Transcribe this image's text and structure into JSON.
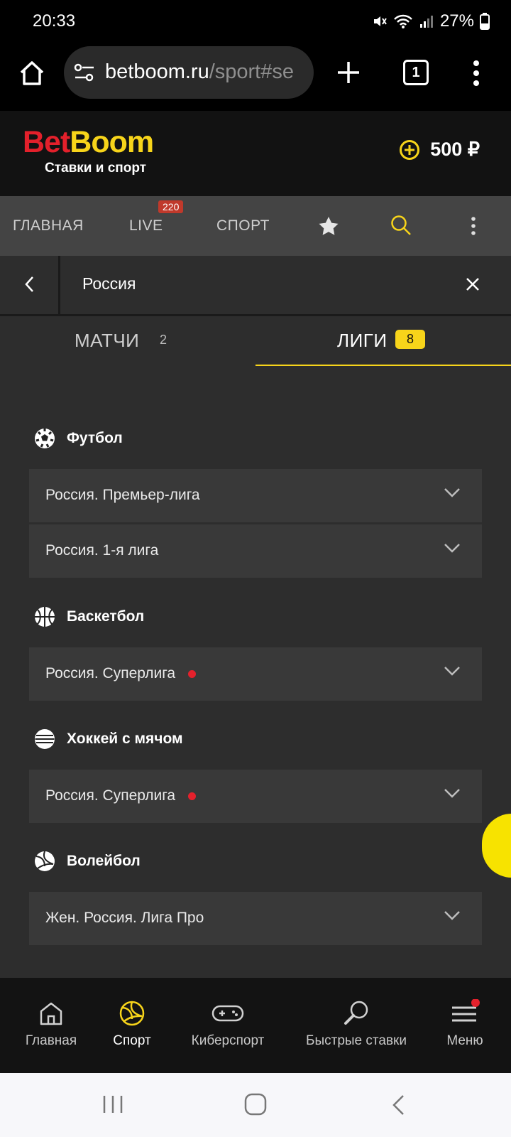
{
  "status_bar": {
    "time": "20:33",
    "battery": "27%"
  },
  "browser": {
    "url_domain": "betboom.ru",
    "url_path": "/sport#se",
    "tab_count": "1"
  },
  "header": {
    "logo_bet": "Bet",
    "logo_boom": "Boom",
    "tagline": "Ставки и спорт",
    "balance": "500 ₽"
  },
  "nav": {
    "items": [
      "ГЛАВНАЯ",
      "LIVE",
      "СПОРТ"
    ],
    "live_count": "220"
  },
  "search": {
    "query": "Россия"
  },
  "tabs": [
    {
      "label": "МАТЧИ",
      "count": "2",
      "selected": false
    },
    {
      "label": "ЛИГИ",
      "count": "8",
      "selected": true
    }
  ],
  "sports": [
    {
      "name": "Футбол",
      "icon": "soccer-ball-icon",
      "leagues": [
        {
          "name": "Россия. Премьер-лига",
          "live": false
        },
        {
          "name": "Россия. 1-я лига",
          "live": false
        }
      ]
    },
    {
      "name": "Баскетбол",
      "icon": "basketball-icon",
      "leagues": [
        {
          "name": "Россия. Суперлига",
          "live": true
        }
      ]
    },
    {
      "name": "Хоккей с мячом",
      "icon": "bandy-ball-icon",
      "leagues": [
        {
          "name": "Россия. Суперлига",
          "live": true
        }
      ]
    },
    {
      "name": "Волейбол",
      "icon": "volleyball-icon",
      "leagues": [
        {
          "name": "Жен. Россия. Лига Про",
          "live": false
        }
      ]
    }
  ],
  "bottom_nav": [
    {
      "label": "Главная",
      "icon": "home-icon",
      "active": false
    },
    {
      "label": "Спорт",
      "icon": "volleyball-icon",
      "active": true
    },
    {
      "label": "Киберспорт",
      "icon": "gamepad-icon",
      "active": false
    },
    {
      "label": "Быстрые ставки",
      "icon": "ping-pong-icon",
      "active": false
    },
    {
      "label": "Меню",
      "icon": "menu-icon",
      "active": false
    }
  ],
  "colors": {
    "accent": "#f7d41a",
    "brand_red": "#e3202b",
    "live": "#e4212c",
    "background": "#2d2d2d"
  }
}
